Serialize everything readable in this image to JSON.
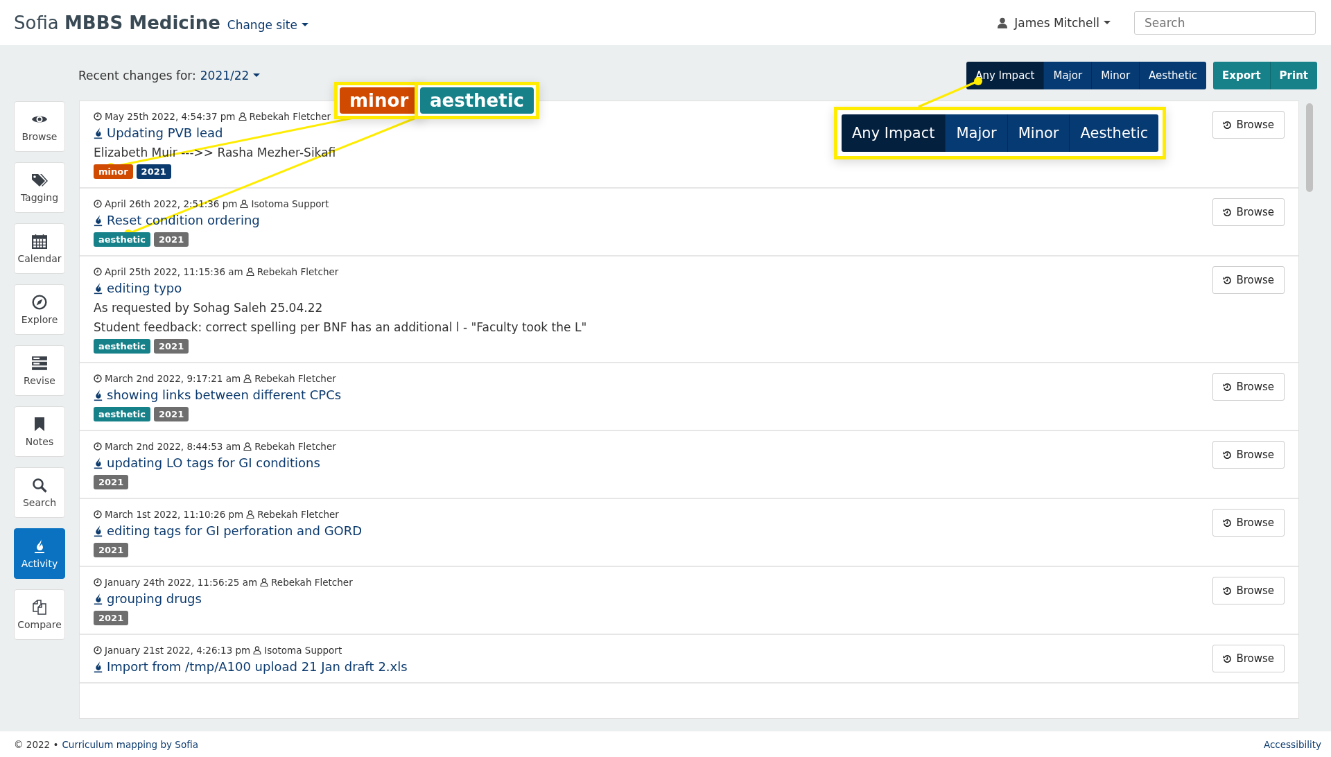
{
  "header": {
    "brand_light": "Sofia",
    "brand_bold": "MBBS Medicine",
    "change_site": "Change site",
    "user": "James Mitchell",
    "search": {
      "placeholder": "Search"
    }
  },
  "toolbar": {
    "label": "Recent changes for:",
    "year": "2021/22",
    "filters": [
      {
        "label": "Any Impact",
        "selected": true
      },
      {
        "label": "Major",
        "selected": false
      },
      {
        "label": "Minor",
        "selected": false
      },
      {
        "label": "Aesthetic",
        "selected": false
      }
    ],
    "actions": [
      "Export",
      "Print"
    ]
  },
  "sidebar": {
    "items": [
      {
        "label": "Browse",
        "selected": false
      },
      {
        "label": "Tagging",
        "selected": false
      },
      {
        "label": "Calendar",
        "selected": false
      },
      {
        "label": "Explore",
        "selected": false
      },
      {
        "label": "Revise",
        "selected": false
      },
      {
        "label": "Notes",
        "selected": false
      },
      {
        "label": "Search",
        "selected": false
      },
      {
        "label": "Activity",
        "selected": true
      },
      {
        "label": "Compare",
        "selected": false
      }
    ]
  },
  "changes": [
    {
      "time": "May 25th 2022, 4:54:37 pm",
      "author": "Rebekah Fletcher",
      "title": "Updating PVB lead",
      "notes": [
        "Elizabeth Muir --->> Rasha Mezher-Sikafi"
      ],
      "tags": [
        {
          "label": "minor",
          "color": "#d04a02"
        },
        {
          "label": "2021",
          "color": "#0b3a6e"
        }
      ],
      "button": "Browse"
    },
    {
      "time": "April 26th 2022, 2:51:36 pm",
      "author": "Isotoma Support",
      "title": "Reset condition ordering",
      "tags": [
        {
          "label": "aesthetic",
          "color": "#17818a"
        },
        {
          "label": "2021",
          "color": "#6e6e6e"
        }
      ],
      "button": "Browse"
    },
    {
      "time": "April 25th 2022, 11:15:36 am",
      "author": "Rebekah Fletcher",
      "title": "editing typo",
      "notes": [
        "As requested by Sohag Saleh 25.04.22",
        "Student feedback: correct spelling per BNF has an additional l - \"Faculty took the L\""
      ],
      "tags": [
        {
          "label": "aesthetic",
          "color": "#17818a"
        },
        {
          "label": "2021",
          "color": "#6e6e6e"
        }
      ],
      "button": "Browse"
    },
    {
      "time": "March 2nd 2022, 9:17:21 am",
      "author": "Rebekah Fletcher",
      "title": "showing links between different CPCs",
      "tags": [
        {
          "label": "aesthetic",
          "color": "#17818a"
        },
        {
          "label": "2021",
          "color": "#6e6e6e"
        }
      ],
      "button": "Browse"
    },
    {
      "time": "March 2nd 2022, 8:44:53 am",
      "author": "Rebekah Fletcher",
      "title": "updating LO tags for GI conditions",
      "tags": [
        {
          "label": "2021",
          "color": "#6e6e6e"
        }
      ],
      "button": "Browse"
    },
    {
      "time": "March 1st 2022, 11:10:26 pm",
      "author": "Rebekah Fletcher",
      "title": "editing tags for GI perforation and GORD",
      "tags": [
        {
          "label": "2021",
          "color": "#6e6e6e"
        }
      ],
      "button": "Browse"
    },
    {
      "time": "January 24th 2022, 11:56:25 am",
      "author": "Rebekah Fletcher",
      "title": "grouping drugs",
      "tags": [
        {
          "label": "2021",
          "color": "#6e6e6e"
        }
      ],
      "button": "Browse"
    },
    {
      "time": "January 21st 2022, 4:26:13 pm",
      "author": "Isotoma Support",
      "title": "Import from /tmp/A100 upload 21 Jan draft 2.xls",
      "button": "Browse"
    }
  ],
  "footer": {
    "copyright": "© 2022 •",
    "credit": "Curriculum mapping by Sofia",
    "accessibility": "Accessibility"
  },
  "callouts": [
    {
      "kind": "tag",
      "label": "minor",
      "color": "#d04a02"
    },
    {
      "kind": "tag",
      "label": "aesthetic",
      "color": "#17818a"
    },
    {
      "kind": "filter",
      "options": [
        {
          "label": "Any Impact",
          "selected": true
        },
        {
          "label": "Major",
          "selected": false
        },
        {
          "label": "Minor",
          "selected": false
        },
        {
          "label": "Aesthetic",
          "selected": false
        }
      ]
    }
  ]
}
